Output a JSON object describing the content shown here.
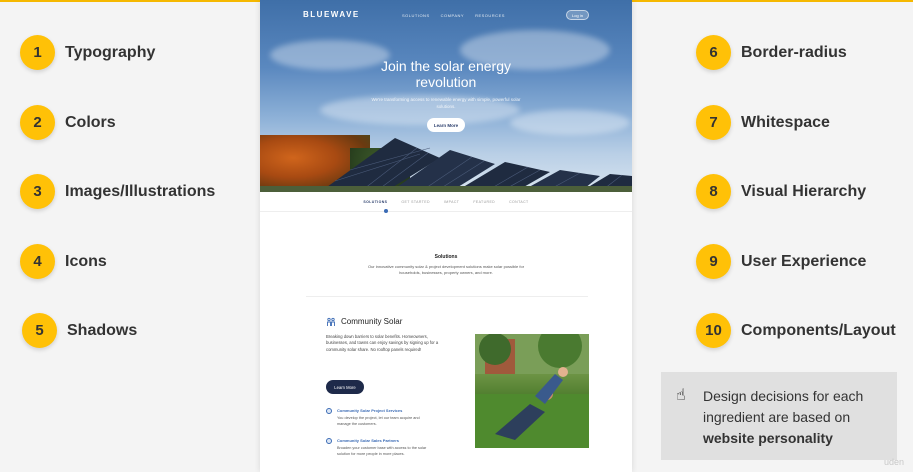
{
  "ingredients_left": [
    {
      "number": "1",
      "label": "Typography"
    },
    {
      "number": "2",
      "label": "Colors"
    },
    {
      "number": "3",
      "label": "Images/Illustrations"
    },
    {
      "number": "4",
      "label": "Icons"
    },
    {
      "number": "5",
      "label": "Shadows"
    }
  ],
  "ingredients_right": [
    {
      "number": "6",
      "label": "Border-radius"
    },
    {
      "number": "7",
      "label": "Whitespace"
    },
    {
      "number": "8",
      "label": "Visual Hierarchy"
    },
    {
      "number": "9",
      "label": "User Experience"
    },
    {
      "number": "10",
      "label": "Components/Layout"
    }
  ],
  "site": {
    "brand": "BLUEWAVE",
    "nav": [
      "SOLUTIONS",
      "COMPANY",
      "RESOURCES"
    ],
    "login": "Log in",
    "hero_title": "Join the solar energy revolution",
    "hero_subtitle": "We're transforming access to renewable energy with simple, powerful solar solutions.",
    "hero_button": "Learn More",
    "tabs": [
      "SOLUTIONS",
      "GET STARTED",
      "IMPACT",
      "FEATURED",
      "CONTACT"
    ],
    "section_title": "Solutions",
    "section_text": "Our innovative community solar & project development solutions make solar possible for households, businesses, property owners, and more.",
    "community_title": "Community Solar",
    "community_body": "Breaking down barriers to solar benefits. Homeowners, businesses, and towns can enjoy savings by signing up for a community solar share. No rooftop panels required!",
    "community_button": "Learn More",
    "features": [
      {
        "title": "Community Solar Project Services",
        "text": "You develop the project, let our team acquire and manage the customers."
      },
      {
        "title": "Community Solar Sales Partners",
        "text": "Broaden your customer base with access to the solar solution for more people in more places."
      }
    ]
  },
  "callout": {
    "icon": "pointing-hand-icon",
    "text_before": "Design decisions for each ingredient are based on",
    "text_bold": "website personality"
  },
  "watermark": "uden"
}
